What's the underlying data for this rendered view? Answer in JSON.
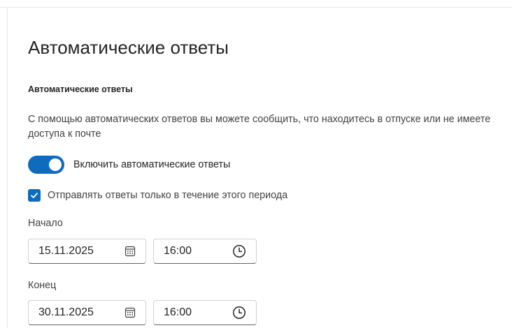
{
  "page": {
    "title": "Автоматические ответы"
  },
  "section": {
    "title": "Автоматические ответы",
    "description": "С помощью автоматических ответов вы можете сообщить, что находитесь в отпуске или не имеете доступа к почте"
  },
  "toggle": {
    "label": "Включить автоматические ответы",
    "state": "on",
    "color": "#0f6cbd"
  },
  "checkbox": {
    "label": "Отправлять ответы только в течение этого периода",
    "checked": true
  },
  "start": {
    "label": "Начало",
    "date": "15.11.2025",
    "time": "16:00",
    "date_icon": "calendar-icon",
    "time_icon": "clock-icon"
  },
  "end": {
    "label": "Конец",
    "date": "30.11.2025",
    "time": "16:00",
    "date_icon": "calendar-icon",
    "time_icon": "clock-icon"
  }
}
